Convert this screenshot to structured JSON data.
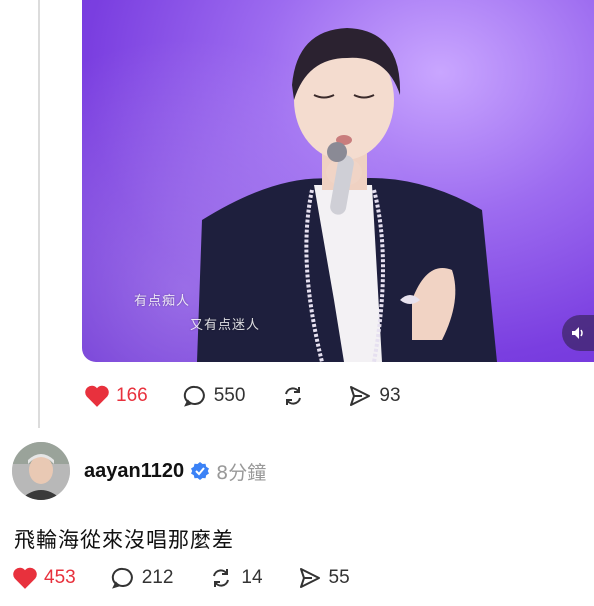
{
  "video": {
    "subtitle_line1": "有点痴人",
    "subtitle_line2": "又有点迷人",
    "volume_icon": "speaker-icon"
  },
  "post_actions": {
    "likes": "166",
    "comments": "550",
    "reposts": "",
    "shares": "93",
    "like_color": "#e8313d"
  },
  "reply": {
    "username": "aayan1120",
    "verified_color": "#3b82f6",
    "time": "8分鐘",
    "text": "飛輪海從來沒唱那麼差",
    "actions": {
      "likes": "453",
      "comments": "212",
      "reposts": "14",
      "shares": "55"
    }
  }
}
